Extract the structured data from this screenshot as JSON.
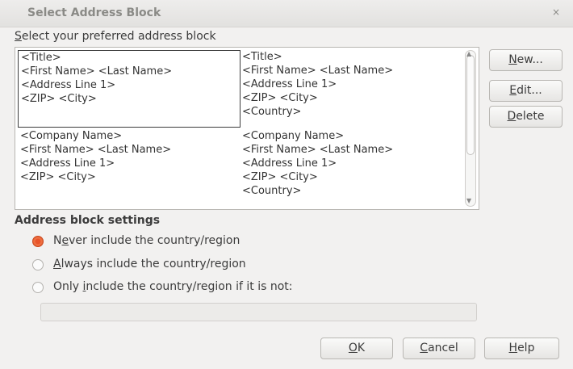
{
  "window": {
    "title": "Select Address Block",
    "close_glyph": "×"
  },
  "list_heading": {
    "underlined": "S",
    "rest": "elect your preferred address block"
  },
  "address_blocks": [
    {
      "text": "<Title>\n<First Name> <Last Name>\n<Address Line 1>\n<ZIP> <City>",
      "selected": true
    },
    {
      "text": "<Title>\n<First Name> <Last Name>\n<Address Line 1>\n<ZIP> <City>\n<Country>",
      "selected": false
    },
    {
      "text": "<Company Name>\n<First Name> <Last Name>\n<Address Line 1>\n<ZIP> <City>",
      "selected": false
    },
    {
      "text": "<Company Name>\n<First Name> <Last Name>\n<Address Line 1>\n<ZIP> <City>\n<Country>",
      "selected": false
    }
  ],
  "side_buttons": {
    "new": {
      "ul": "N",
      "rest": "ew..."
    },
    "edit": {
      "ul": "E",
      "rest": "dit..."
    },
    "delete": {
      "ul": "D",
      "rest": "elete"
    }
  },
  "settings": {
    "title": "Address block settings",
    "never": {
      "pre": "N",
      "ul": "e",
      "post": "ver include the country/region",
      "checked": true
    },
    "always": {
      "pre": "",
      "ul": "A",
      "post": "lways include the country/region",
      "checked": false
    },
    "only": {
      "pre": "Only ",
      "ul": "i",
      "post": "nclude the country/region if it is not:",
      "checked": false
    },
    "country_field_value": ""
  },
  "footer_buttons": {
    "ok": {
      "ul": "O",
      "rest": "K"
    },
    "cancel": {
      "ul": "C",
      "rest": "ancel"
    },
    "help": {
      "ul": "H",
      "rest": "elp"
    }
  },
  "colors": {
    "radio_accent": "#e8542a",
    "dialog_bg": "#f2f1f0"
  }
}
